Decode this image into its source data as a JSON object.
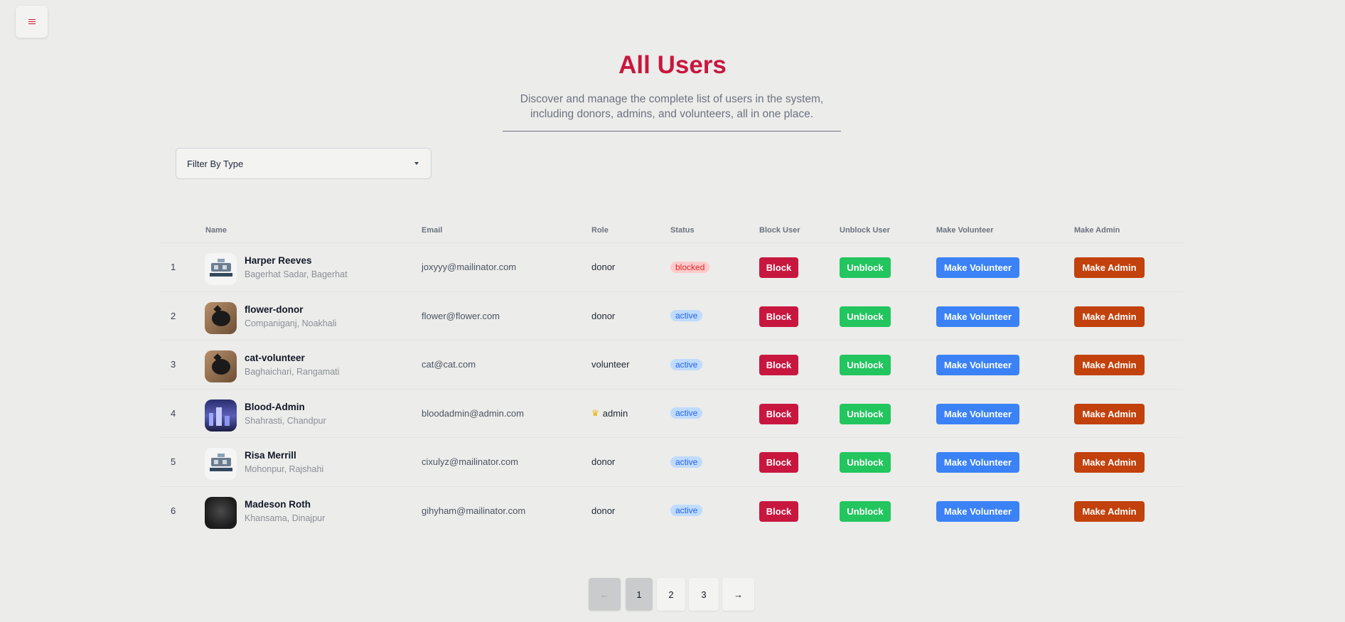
{
  "page": {
    "title": "All Users",
    "subtitle": "Discover and manage the complete list of users in the system, including donors, admins, and volunteers, all in one place."
  },
  "filter": {
    "label": "Filter By Type"
  },
  "table": {
    "headers": {
      "name": "Name",
      "email": "Email",
      "role": "Role",
      "status": "Status",
      "block": "Block User",
      "unblock": "Unblock User",
      "volunteer": "Make Volunteer",
      "admin": "Make Admin"
    },
    "rows": [
      {
        "index": "1",
        "name": "Harper Reeves",
        "address": "Bagerhat Sadar, Bagerhat",
        "email": "joxyyy@mailinator.com",
        "role": "donor",
        "status": "blocked",
        "avatar": "robot-icon"
      },
      {
        "index": "2",
        "name": "flower-donor",
        "address": "Companiganj, Noakhali",
        "email": "flower@flower.com",
        "role": "donor",
        "status": "active",
        "avatar": "cat-photo"
      },
      {
        "index": "3",
        "name": "cat-volunteer",
        "address": "Baghaichari, Rangamati",
        "email": "cat@cat.com",
        "role": "volunteer",
        "status": "active",
        "avatar": "cat-photo"
      },
      {
        "index": "4",
        "name": "Blood-Admin",
        "address": "Shahrasti, Chandpur",
        "email": "bloodadmin@admin.com",
        "role": "admin",
        "status": "active",
        "avatar": "city-photo"
      },
      {
        "index": "5",
        "name": "Risa Merrill",
        "address": "Mohonpur, Rajshahi",
        "email": "cixulyz@mailinator.com",
        "role": "donor",
        "status": "active",
        "avatar": "robot-icon"
      },
      {
        "index": "6",
        "name": "Madeson Roth",
        "address": "Khansama, Dinajpur",
        "email": "gihyham@mailinator.com",
        "role": "donor",
        "status": "active",
        "avatar": "dark-photo"
      }
    ],
    "buttons": {
      "block": "Block",
      "unblock": "Unblock",
      "volunteer": "Make Volunteer",
      "admin": "Make Admin"
    }
  },
  "pagination": {
    "pages": [
      "1",
      "2",
      "3"
    ],
    "current": "1",
    "prev_icon": "arrow-left-icon",
    "next_icon": "arrow-right-icon"
  },
  "colors": {
    "accent": "#c8173f",
    "block": "#c8173f",
    "unblock": "#22c55e",
    "volunteer": "#3b82f6",
    "admin": "#c2410c",
    "badge_blocked": "#fecaca",
    "badge_active": "#bfdbfe"
  }
}
